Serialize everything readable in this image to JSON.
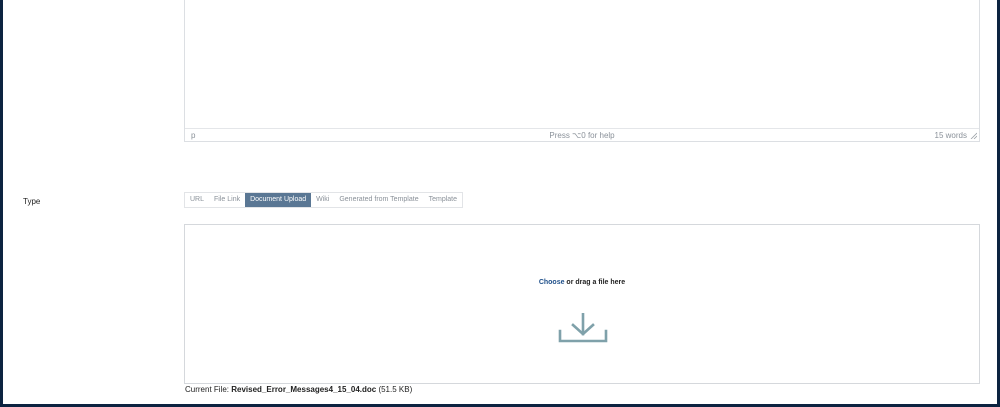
{
  "editor": {
    "status_path": "p",
    "status_help": "Press ⌥0 for help",
    "status_words": "15 words"
  },
  "type_field": {
    "label": "Type",
    "tabs": [
      {
        "label": "URL",
        "active": false
      },
      {
        "label": "File Link",
        "active": false
      },
      {
        "label": "Document Upload",
        "active": true
      },
      {
        "label": "Wiki",
        "active": false
      },
      {
        "label": "Generated from Template",
        "active": false
      },
      {
        "label": "Template",
        "active": false
      }
    ]
  },
  "dropzone": {
    "choose": "Choose",
    "rest": " or drag a file here",
    "icon": "download-icon"
  },
  "current_file": {
    "prefix": "Current File: ",
    "filename": "Revised_Error_Messages4_15_04.doc",
    "size": " (51.5 KB)"
  },
  "colors": {
    "frame": "#0c2340",
    "active_tab": "#5a7794",
    "icon": "#7fa1aa",
    "link": "#1e4f8a"
  }
}
